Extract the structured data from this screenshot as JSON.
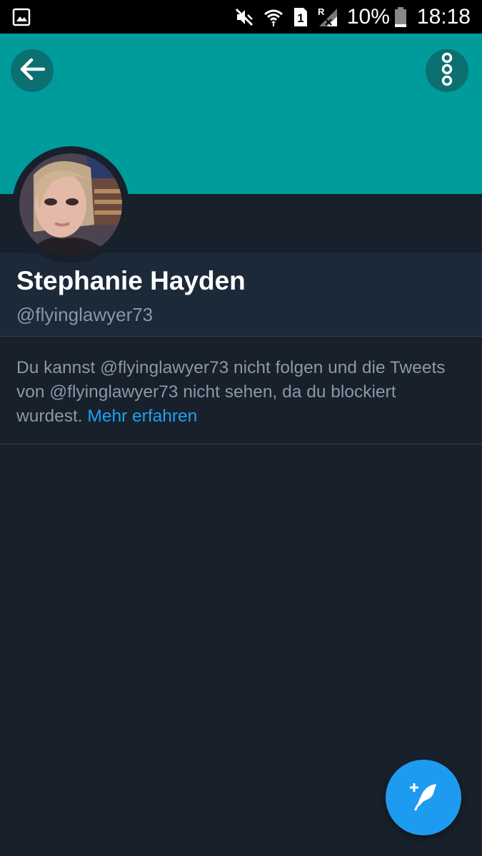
{
  "status_bar": {
    "battery_percent": "10%",
    "time": "18:18",
    "sim_label": "1",
    "roaming_label": "R",
    "icons": [
      "gallery-icon",
      "mute-icon",
      "wifi-icon",
      "sim-icon",
      "signal-icon",
      "battery-icon"
    ]
  },
  "header": {
    "banner_color": "#009b9b",
    "back_icon": "arrow-left-icon",
    "more_icon": "more-vertical-icon"
  },
  "profile": {
    "display_name": "Stephanie Hayden",
    "handle": "@flyinglawyer73"
  },
  "blocked_notice": {
    "text": "Du kannst @flyinglawyer73 nicht folgen und die Tweets von @flyinglawyer73 nicht sehen, da du blockiert wurdest. ",
    "link": "Mehr erfahren",
    "link_color": "#1da1f2"
  },
  "fab": {
    "icon": "compose-tweet-icon",
    "color": "#1d9bf0"
  }
}
